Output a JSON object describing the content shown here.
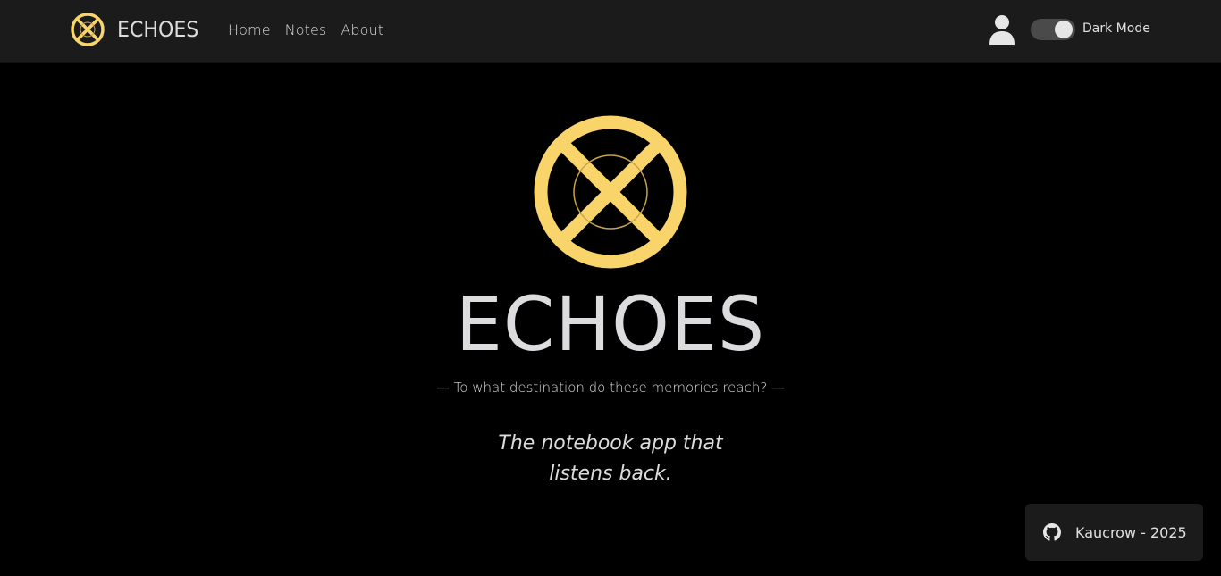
{
  "brand": {
    "name": "ECHOES",
    "icon": "echoes-x-circle-icon",
    "accent_color": "#f9d46b"
  },
  "nav": {
    "links": [
      {
        "label": "Home"
      },
      {
        "label": "Notes"
      },
      {
        "label": "About"
      }
    ]
  },
  "header_right": {
    "user_icon": "user-icon",
    "dark_mode_label": "Dark Mode",
    "dark_mode_on": true
  },
  "hero": {
    "title": "ECHOES",
    "tagline": "— To what destination do these memories reach? —",
    "subtitle_line1": "The notebook app that",
    "subtitle_line2": "listens back."
  },
  "footer": {
    "icon": "github-icon",
    "text": "Kaucrow - 2025"
  },
  "colors": {
    "background": "#000000",
    "navbar": "#1b1b1b",
    "accent": "#f9d46b",
    "text": "#dcdcdc"
  }
}
